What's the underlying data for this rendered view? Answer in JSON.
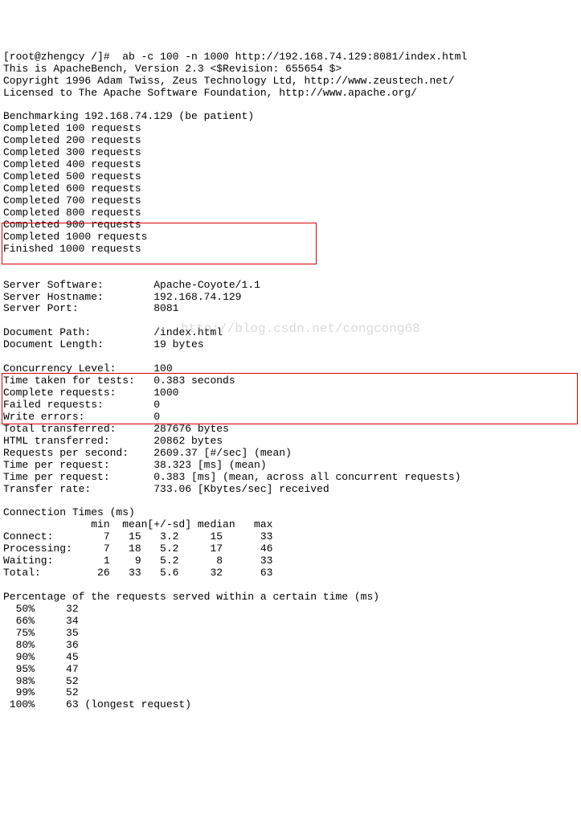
{
  "cmd_prompt": "[root@zhengcy /]#  ab -c 100 -n 1000 http://192.168.74.129:8081/index.html",
  "header_l1": "This is ApacheBench, Version 2.3 <$Revision: 655654 $>",
  "header_l2": "Copyright 1996 Adam Twiss, Zeus Technology Ltd, http://www.zeustech.net/",
  "header_l3": "Licensed to The Apache Software Foundation, http://www.apache.org/",
  "benchmarking": "Benchmarking 192.168.74.129 (be patient)",
  "completed": [
    "Completed 100 requests",
    "Completed 200 requests",
    "Completed 300 requests",
    "Completed 400 requests",
    "Completed 500 requests",
    "Completed 600 requests",
    "Completed 700 requests",
    "Completed 800 requests",
    "Completed 900 requests",
    "Completed 1000 requests",
    "Finished 1000 requests"
  ],
  "server": {
    "software_label": "Server Software:",
    "software_value": "Apache-Coyote/1.1",
    "hostname_label": "Server Hostname:",
    "hostname_value": "192.168.74.129",
    "port_label": "Server Port:",
    "port_value": "8081"
  },
  "document": {
    "path_label": "Document Path:",
    "path_value": "/index.html",
    "length_label": "Document Length:",
    "length_value": "19 bytes"
  },
  "stats": {
    "concurrency_label": "Concurrency Level:",
    "concurrency_value": "100",
    "time_taken_label": "Time taken for tests:",
    "time_taken_value": "0.383 seconds",
    "complete_label": "Complete requests:",
    "complete_value": "1000",
    "failed_label": "Failed requests:",
    "failed_value": "0",
    "write_errors_label": "Write errors:",
    "write_errors_value": "0",
    "total_transferred_label": "Total transferred:",
    "total_transferred_value": "287676 bytes",
    "html_transferred_label": "HTML transferred:",
    "html_transferred_value": "20862 bytes"
  },
  "rates": {
    "rps_label": "Requests per second:",
    "rps_value": "2609.37 [#/sec] (mean)",
    "tpr1_label": "Time per request:",
    "tpr1_value": "38.323 [ms] (mean)",
    "tpr2_label": "Time per request:",
    "tpr2_value": "0.383 [ms] (mean, across all concurrent requests)",
    "transfer_label": "Transfer rate:",
    "transfer_value": "733.06 [Kbytes/sec] received"
  },
  "conn_times_header": "Connection Times (ms)",
  "conn_times_cols": "              min  mean[+/-sd] median   max",
  "conn_times": {
    "connect": "Connect:        7   15   3.2     15      33",
    "processing": "Processing:     7   18   5.2     17      46",
    "waiting": "Waiting:        1    9   5.2      8      33",
    "total": "Total:         26   33   5.6     32      63"
  },
  "percentile_header": "Percentage of the requests served within a certain time (ms)",
  "percentiles": [
    "  50%     32",
    "  66%     34",
    "  75%     35",
    "  80%     36",
    "  90%     45",
    "  95%     47",
    "  98%     52",
    "  99%     52",
    " 100%     63 (longest request)"
  ],
  "watermark": "http://blog.csdn.net/congcong68"
}
